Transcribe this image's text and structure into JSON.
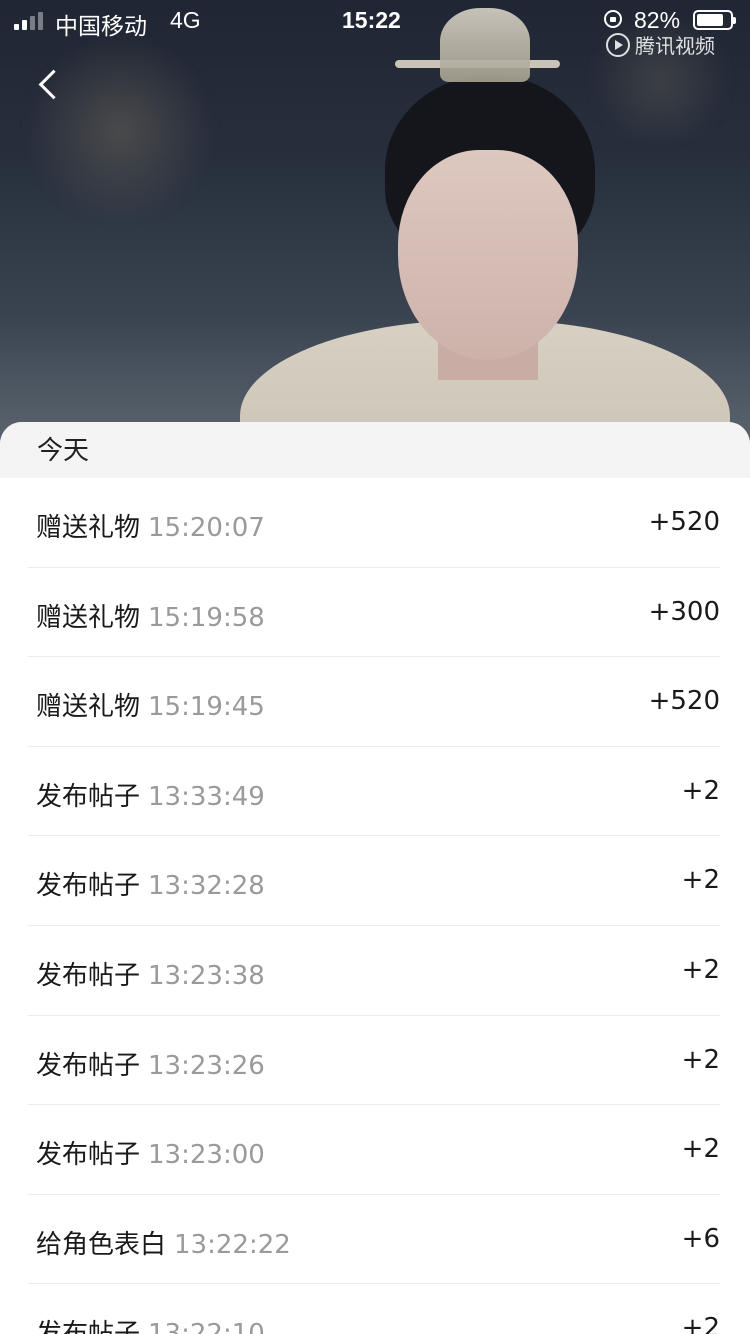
{
  "status_bar": {
    "carrier": "中国移动",
    "network": "4G",
    "time": "15:22",
    "battery_percent": "82%",
    "battery_level": 0.82,
    "signal_bars": 2,
    "signal_bars_total": 4
  },
  "watermark": {
    "text": "腾讯视频",
    "icon": "play-logo-icon"
  },
  "nav": {
    "back_icon": "chevron-left-icon"
  },
  "section": {
    "title": "今天"
  },
  "records": [
    {
      "action": "赠送礼物",
      "time": "15:20:07",
      "points": "+520"
    },
    {
      "action": "赠送礼物",
      "time": "15:19:58",
      "points": "+300"
    },
    {
      "action": "赠送礼物",
      "time": "15:19:45",
      "points": "+520"
    },
    {
      "action": "发布帖子",
      "time": "13:33:49",
      "points": "+2"
    },
    {
      "action": "发布帖子",
      "time": "13:32:28",
      "points": "+2"
    },
    {
      "action": "发布帖子",
      "time": "13:23:38",
      "points": "+2"
    },
    {
      "action": "发布帖子",
      "time": "13:23:26",
      "points": "+2"
    },
    {
      "action": "发布帖子",
      "time": "13:23:00",
      "points": "+2"
    },
    {
      "action": "给角色表白",
      "time": "13:22:22",
      "points": "+6"
    },
    {
      "action": "发布帖子",
      "time": "13:22:10",
      "points": "+2"
    }
  ],
  "colors": {
    "text_primary": "#1a1a1a",
    "text_secondary": "#9a9a9a",
    "section_bg": "#f4f4f4",
    "divider": "#ececec"
  }
}
